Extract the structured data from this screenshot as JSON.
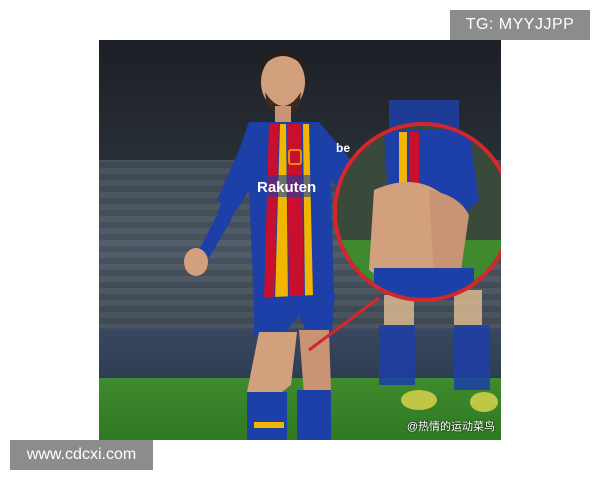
{
  "watermarks": {
    "top": "TG: MYYJJPP",
    "bottom": "www.cdcxi.com"
  },
  "photo": {
    "credit": "@热情的运动菜鸟",
    "jersey_sponsor": "Rakuten",
    "jersey_brand_right": "be"
  },
  "colors": {
    "jersey_blue": "#1d3fa8",
    "jersey_red": "#c8102e",
    "jersey_gold": "#f2b600",
    "callout_red": "#d7262b",
    "pitch_green": "#2f7a22",
    "watermark_gray": "#8c8c8c"
  }
}
